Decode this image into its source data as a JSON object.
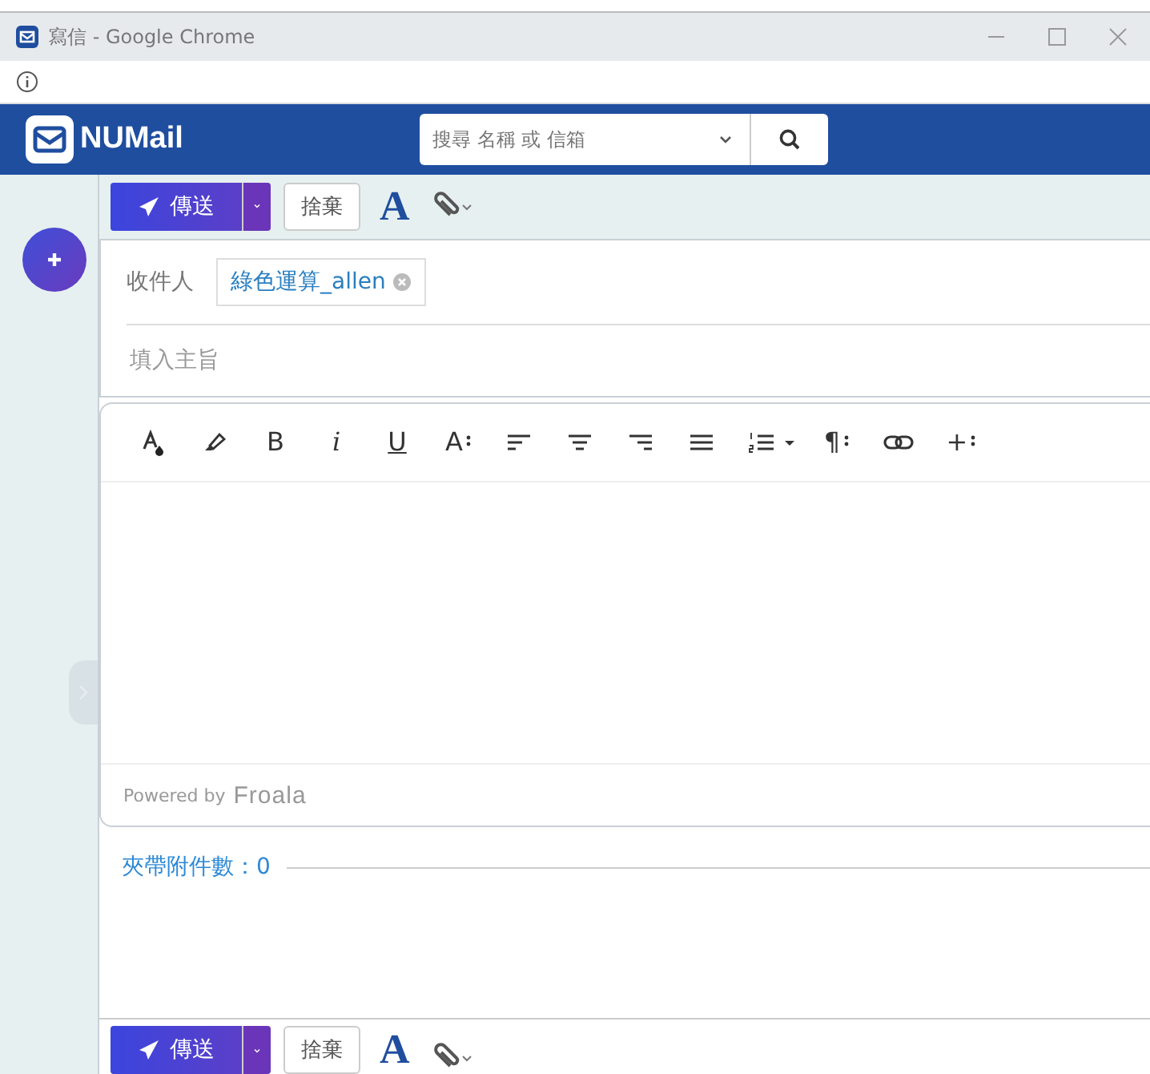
{
  "window": {
    "title": "寫信 - Google Chrome"
  },
  "header": {
    "logo": "NUMail",
    "search": {
      "placeholder": "搜尋 名稱 或 信箱"
    }
  },
  "toolbar_top": {
    "send": "傳送",
    "discard": "捨棄",
    "font": "A"
  },
  "recipients": {
    "label": "收件人",
    "chips": [
      {
        "name": "綠色運算_allen"
      }
    ]
  },
  "subject": {
    "placeholder": "填入主旨"
  },
  "editor_tools": [
    "B",
    "i",
    "U",
    "A",
    "¶",
    "+"
  ],
  "editor_footer": {
    "powered": "Powered by",
    "brand": "Froala"
  },
  "attachments": {
    "label": "夾帶附件數：0"
  },
  "toolbar_bottom": {
    "send": "傳送",
    "discard": "捨棄",
    "font": "A"
  }
}
